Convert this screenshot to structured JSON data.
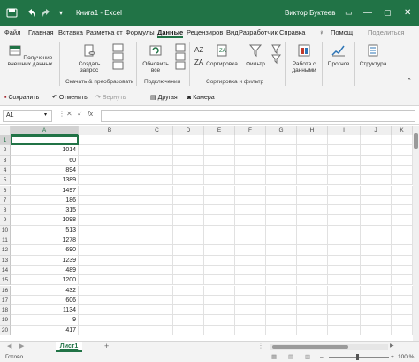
{
  "window": {
    "title": "Книга1 - Excel",
    "user": "Виктор Буктеев"
  },
  "menu": {
    "tabs": [
      "Файл",
      "Главная",
      "Вставка",
      "Разметка ст",
      "Формулы",
      "Данные",
      "Рецензиров",
      "Вид",
      "Разработчик",
      "Справка"
    ],
    "active": "Данные",
    "help": "Помощ",
    "share": "Поделиться"
  },
  "ribbon": {
    "get_external": "Получение внешних данных",
    "new_query": "Создать запрос",
    "group_transform": "Скачать & преобразовать",
    "refresh_all": "Обновить все",
    "group_connections": "Подключения",
    "sort": "Сортировка",
    "filter": "Фильтр",
    "group_sort_filter": "Сортировка и фильтр",
    "data_tools": "Работа с данными",
    "forecast": "Прогноз",
    "outline": "Структура"
  },
  "qat": {
    "save": "Сохранить",
    "undo": "Отменить",
    "redo": "Вернуть",
    "other": "Другая",
    "camera": "Камера"
  },
  "formula": {
    "namebox": "A1",
    "value": ""
  },
  "grid": {
    "columns": [
      "A",
      "B",
      "C",
      "D",
      "E",
      "F",
      "G",
      "H",
      "I",
      "J",
      "K"
    ],
    "rows": [
      {
        "num": "1",
        "a": ""
      },
      {
        "num": "2",
        "a": "1014"
      },
      {
        "num": "3",
        "a": "60"
      },
      {
        "num": "4",
        "a": "894"
      },
      {
        "num": "5",
        "a": "1389"
      },
      {
        "num": "6",
        "a": "1497"
      },
      {
        "num": "7",
        "a": "186"
      },
      {
        "num": "8",
        "a": "315"
      },
      {
        "num": "9",
        "a": "1098"
      },
      {
        "num": "10",
        "a": "513"
      },
      {
        "num": "11",
        "a": "1278"
      },
      {
        "num": "12",
        "a": "690"
      },
      {
        "num": "13",
        "a": "1239"
      },
      {
        "num": "14",
        "a": "489"
      },
      {
        "num": "15",
        "a": "1200"
      },
      {
        "num": "16",
        "a": "432"
      },
      {
        "num": "17",
        "a": "606"
      },
      {
        "num": "18",
        "a": "1134"
      },
      {
        "num": "19",
        "a": "9"
      },
      {
        "num": "20",
        "a": "417"
      }
    ]
  },
  "sheets": {
    "active": "Лист1",
    "add": "+"
  },
  "status": {
    "ready": "Готово",
    "zoom": "100 %"
  },
  "colors": {
    "accent": "#217346"
  }
}
